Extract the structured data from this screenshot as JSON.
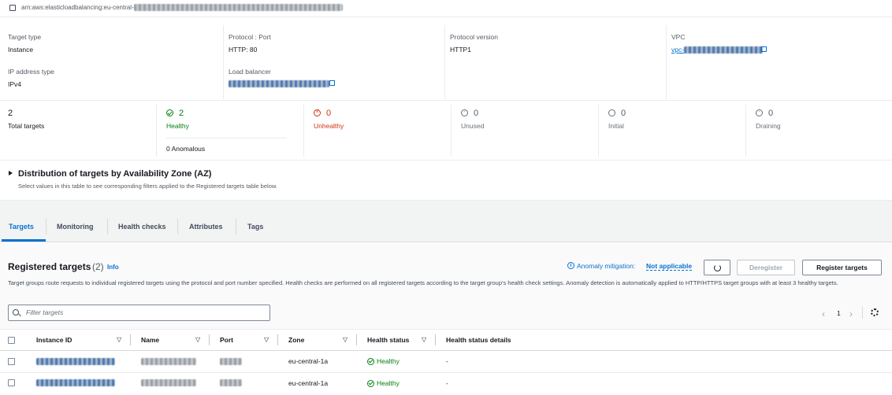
{
  "arn": {
    "prefix": "arn:aws:elasticloadbalancing:eu-central-1"
  },
  "details": {
    "target_type_label": "Target type",
    "target_type_value": "Instance",
    "ip_type_label": "IP address type",
    "ip_type_value": "IPv4",
    "protocol_port_label": "Protocol : Port",
    "protocol_port_value": "HTTP: 80",
    "load_balancer_label": "Load balancer",
    "protocol_version_label": "Protocol version",
    "protocol_version_value": "HTTP1",
    "vpc_label": "VPC",
    "vpc_prefix": "vpc-"
  },
  "stats": {
    "total": {
      "count": "2",
      "label": "Total targets"
    },
    "healthy": {
      "count": "2",
      "label": "Healthy",
      "anomalous": "0 Anomalous"
    },
    "unhealthy": {
      "count": "0",
      "label": "Unhealthy"
    },
    "unused": {
      "count": "0",
      "label": "Unused"
    },
    "initial": {
      "count": "0",
      "label": "Initial"
    },
    "draining": {
      "count": "0",
      "label": "Draining"
    }
  },
  "az": {
    "title": "Distribution of targets by Availability Zone (AZ)",
    "description": "Select values in this table to see corresponding filters applied to the Registered targets table below."
  },
  "tabs": [
    "Targets",
    "Monitoring",
    "Health checks",
    "Attributes",
    "Tags"
  ],
  "registered": {
    "title": "Registered targets",
    "count": "(2)",
    "info": "Info",
    "anomaly_label": "Anomaly mitigation:",
    "anomaly_value": "Not applicable",
    "deregister": "Deregister",
    "register": "Register targets",
    "description": "Target groups route requests to individual registered targets using the protocol and port number specified. Health checks are performed on all registered targets according to the target group's health check settings. Anomaly detection is automatically applied to HTTP/HTTPS target groups with at least 3 healthy targets.",
    "filter_placeholder": "Filter targets",
    "page": "1"
  },
  "table": {
    "columns": [
      "Instance ID",
      "Name",
      "Port",
      "Zone",
      "Health status",
      "Health status details"
    ],
    "rows": [
      {
        "zone": "eu-central-1a",
        "health": "Healthy",
        "details": "-"
      },
      {
        "zone": "eu-central-1a",
        "health": "Healthy",
        "details": "-"
      }
    ]
  },
  "colors": {
    "accent": "#0972d3",
    "healthy": "#037f0c",
    "unhealthy": "#d13212"
  }
}
